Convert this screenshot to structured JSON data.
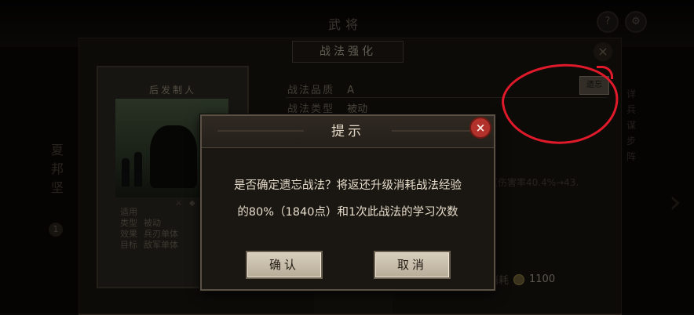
{
  "top_bar": {
    "title": "武将",
    "help_icon": "?",
    "settings_icon": "⚙"
  },
  "panel": {
    "header_title": "战法强化",
    "close_icon": "×",
    "card": {
      "title": "后发制人",
      "info": [
        {
          "label": "适用",
          "value": ""
        },
        {
          "label": "类型",
          "value": "被动"
        },
        {
          "label": "效果",
          "value": "兵刃单体"
        },
        {
          "label": "目标",
          "value": "敌军单体"
        }
      ]
    },
    "stats": {
      "quality_label": "战法品质",
      "quality_value": "A",
      "type_label": "战法类型",
      "type_value": "被动"
    },
    "forget_button": "遗忘",
    "effect_text": "（伤害率40.4%→43.",
    "cost_label": "消耗",
    "cost_value": "1100",
    "left_side_chars": [
      "夏",
      "邦",
      "坚"
    ],
    "left_badge": "1",
    "right_side_chars": [
      "详",
      "兵",
      "谋",
      "步",
      "阵"
    ]
  },
  "dialog": {
    "title": "提示",
    "close_icon": "×",
    "message_line1": "是否确定遗忘战法？将返还升级消耗战法经验",
    "message_line2": "的80%（1840点）和1次此战法的学习次数",
    "confirm_label": "确认",
    "cancel_label": "取消"
  },
  "colors": {
    "annotation": "#e01a2a",
    "dialog_close": "#b3312b",
    "button_bg": "#d8cfbd"
  }
}
